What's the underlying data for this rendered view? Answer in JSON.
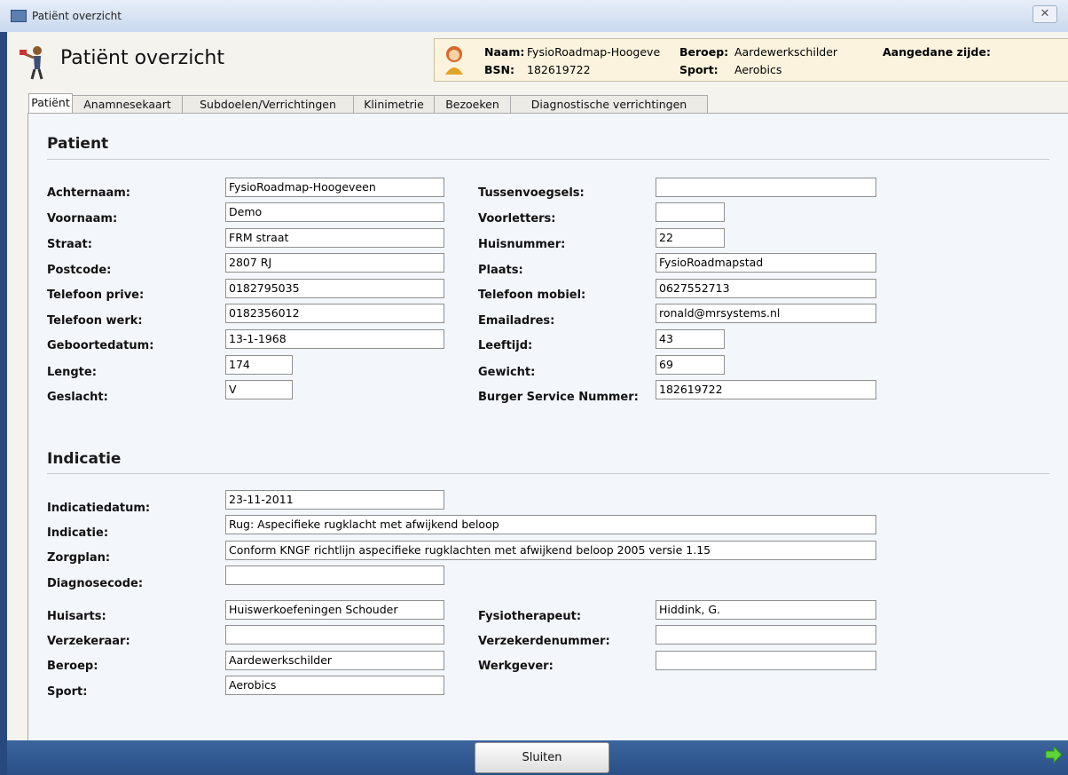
{
  "window": {
    "title": "Patiënt overzicht"
  },
  "header": {
    "title": "Patiënt overzicht"
  },
  "info": {
    "naam_label": "Naam:",
    "naam_value": "FysioRoadmap-Hoogeve",
    "bsn_label": "BSN:",
    "bsn_value": "182619722",
    "beroep_label": "Beroep:",
    "beroep_value": "Aardewerkschilder",
    "sport_label": "Sport:",
    "sport_value": "Aerobics",
    "zijde_label": "Aangedane zijde:"
  },
  "tabs": [
    {
      "label": "Patiënt",
      "active": true
    },
    {
      "label": "Anamnesekaart"
    },
    {
      "label": "Subdoelen/Verrichtingen"
    },
    {
      "label": "Klinimetrie"
    },
    {
      "label": "Bezoeken"
    },
    {
      "label": "Diagnostische verrichtingen"
    }
  ],
  "patient": {
    "title": "Patient",
    "left": [
      {
        "label": "Achternaam:",
        "value": "FysioRoadmap-Hoogeveen"
      },
      {
        "label": "Voornaam:",
        "value": "Demo"
      },
      {
        "label": "Straat:",
        "value": "FRM straat"
      },
      {
        "label": "Postcode:",
        "value": "2807 RJ"
      },
      {
        "label": "Telefoon prive:",
        "value": "0182795035"
      },
      {
        "label": "Telefoon werk:",
        "value": "0182356012"
      },
      {
        "label": "Geboortedatum:",
        "value": "13-1-1968"
      },
      {
        "label": "Lengte:",
        "value": "174"
      },
      {
        "label": "Geslacht:",
        "value": "V"
      }
    ],
    "right": [
      {
        "label": "Tussenvoegsels:",
        "value": ""
      },
      {
        "label": "Voorletters:",
        "value": ""
      },
      {
        "label": "Huisnummer:",
        "value": "22"
      },
      {
        "label": "Plaats:",
        "value": "FysioRoadmapstad"
      },
      {
        "label": "Telefoon mobiel:",
        "value": "0627552713"
      },
      {
        "label": "Emailadres:",
        "value": "ronald@mrsystems.nl"
      },
      {
        "label": "Leeftijd:",
        "value": "43"
      },
      {
        "label": "Gewicht:",
        "value": "69"
      },
      {
        "label": "Burger Service Nummer:",
        "value": "182619722"
      }
    ]
  },
  "indicatie": {
    "title": "Indicatie",
    "fields": [
      {
        "label": "Indicatiedatum:",
        "value": "23-11-2011"
      },
      {
        "label": "Indicatie:",
        "value": "Rug: Aspecifieke rugklacht met afwijkend beloop"
      },
      {
        "label": "Zorgplan:",
        "value": "Conform KNGF richtlijn aspecifieke rugklachten met afwijkend beloop 2005 versie 1.15"
      },
      {
        "label": "Diagnosecode:",
        "value": ""
      }
    ],
    "left": [
      {
        "label": "Huisarts:",
        "value": "Huiswerkoefeningen Schouder"
      },
      {
        "label": "Verzekeraar:",
        "value": ""
      },
      {
        "label": "Beroep:",
        "value": "Aardewerkschilder"
      },
      {
        "label": "Sport:",
        "value": "Aerobics"
      }
    ],
    "right": [
      {
        "label": "Fysiotherapeut:",
        "value": "Hiddink, G."
      },
      {
        "label": "Verzekerdenummer:",
        "value": ""
      },
      {
        "label": "Werkgever:",
        "value": ""
      }
    ]
  },
  "footer": {
    "close_label": "Sluiten"
  },
  "colors": {
    "accent": "#2a4f86",
    "info_bg": "#fbf3dd",
    "content_bg": "#f3f6fb"
  }
}
